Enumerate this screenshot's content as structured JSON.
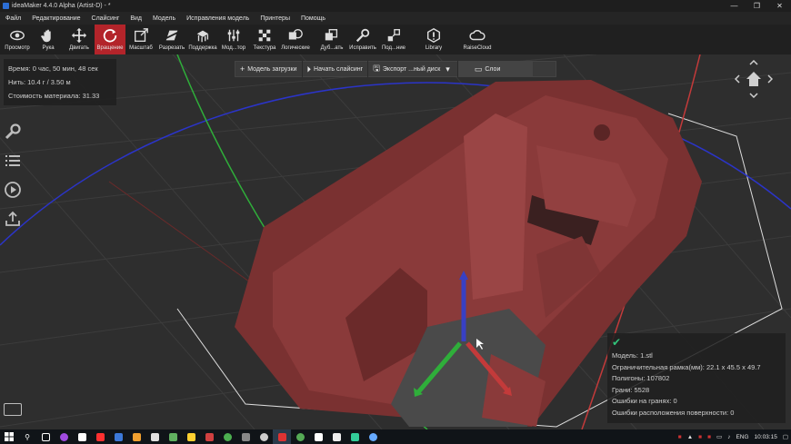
{
  "window": {
    "title": "ideaMaker 4.4.0 Alpha (Artist-D) - *",
    "minimize": "—",
    "maximize": "❐",
    "close": "✕"
  },
  "menu": [
    "Файл",
    "Редактирование",
    "Слайсинг",
    "Вид",
    "Модель",
    "Исправления модель",
    "Принтеры",
    "Помощь"
  ],
  "toolbar": [
    {
      "label": "Просмотр",
      "icon": "eye-icon"
    },
    {
      "label": "Рука",
      "icon": "hand-icon"
    },
    {
      "label": "Двигать",
      "icon": "move-icon"
    },
    {
      "label": "Вращение",
      "icon": "rotate-icon",
      "active": true
    },
    {
      "label": "Масштаб",
      "icon": "scale-icon"
    },
    {
      "label": "Разрезать",
      "icon": "cut-icon"
    },
    {
      "label": "Поддержка",
      "icon": "support-icon"
    },
    {
      "label": "Мод...тор",
      "icon": "modifier-icon"
    },
    {
      "label": "Текстура",
      "icon": "texture-icon"
    },
    {
      "label": "Логические",
      "icon": "boolean-icon"
    },
    {
      "label": "Дуб...ать",
      "icon": "duplicate-icon"
    },
    {
      "label": "Исправить",
      "icon": "repair-icon"
    },
    {
      "label": "Под...ние",
      "icon": "connect-icon"
    },
    {
      "label": "Library",
      "icon": "library-icon"
    },
    {
      "label": "RaiseCloud",
      "icon": "cloud-icon"
    }
  ],
  "info_tl": {
    "time": "Время: 0 час, 50 мин, 48 сек",
    "filament": "Нить: 10.4 г / 3.50 м",
    "cost": "Стоимость материала: 31.33"
  },
  "actionbar": {
    "load_model": "Модель загрузки",
    "start_slicing": "Начать слайсинг",
    "export": "Экспорт ...ный диск",
    "layers": "Слои"
  },
  "model_info": {
    "model": "Модель: 1.stl",
    "bbox": "Ограничительная рамка(мм): 22.1 x 45.5 x 49.7",
    "polygons": "Полигоны: 107802",
    "faces": "Грани: 5528",
    "face_errors": "Ошибки на гранях: 0",
    "surface_errors": "Ошибки расположения поверхности: 0"
  },
  "taskbar": {
    "lang": "ENG",
    "time": "10:03:15"
  },
  "colors": {
    "accent": "#b3242a",
    "model": "#7a3131",
    "axis_green": "#2fae3a",
    "axis_red": "#c33a3a",
    "axis_blue": "#3840c4",
    "ok_green": "#33c37a"
  }
}
